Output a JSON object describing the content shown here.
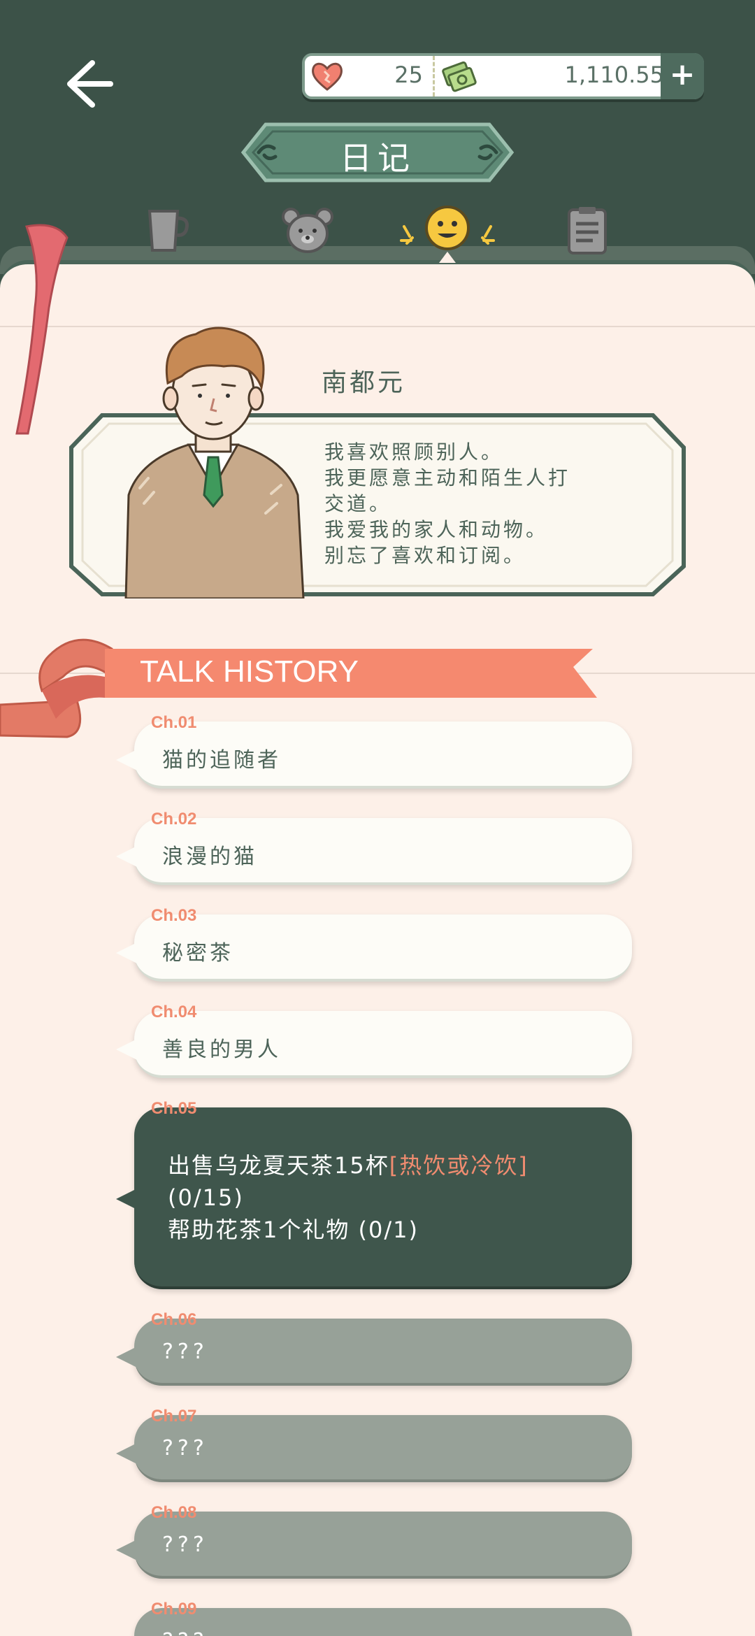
{
  "header": {
    "title": "日记",
    "hearts": "25",
    "money": "1,110.55",
    "add_label": "+"
  },
  "tabs": [
    {
      "name": "cup",
      "icon": "coffee-cup-icon"
    },
    {
      "name": "bear",
      "icon": "bear-icon"
    },
    {
      "name": "smile",
      "icon": "smiley-face-icon",
      "selected": true
    },
    {
      "name": "notes",
      "icon": "notes-icon"
    }
  ],
  "profile": {
    "name": "南都元",
    "desc_lines": [
      "我喜欢照顾别人。",
      "我更愿意主动和陌生人打",
      "交道。",
      "我爱我的家人和动物。",
      "别忘了喜欢和订阅。"
    ]
  },
  "talk_history": {
    "title": "TALK HISTORY",
    "chapters": [
      {
        "label": "Ch.01",
        "text": "猫的追随者"
      },
      {
        "label": "Ch.02",
        "text": "浪漫的猫"
      },
      {
        "label": "Ch.03",
        "text": "秘密茶"
      },
      {
        "label": "Ch.04",
        "text": "善良的男人"
      },
      {
        "label": "Ch.05",
        "line1": "出售乌龙夏天茶15杯",
        "line1_hl": "[热饮或冷饮]",
        "line2": "(0/15)",
        "line3": "帮助花茶1个礼物 (0/1)"
      },
      {
        "label": "Ch.06",
        "text": "???"
      },
      {
        "label": "Ch.07",
        "text": "???"
      },
      {
        "label": "Ch.08",
        "text": "???"
      },
      {
        "label": "Ch.09",
        "text": "???"
      }
    ]
  },
  "colors": {
    "header_bg": "#3c5248",
    "paper_bg": "#fdf0e8",
    "accent_salmon": "#f08c70",
    "text_green": "#4d6459",
    "locked_gray": "#97a198"
  }
}
